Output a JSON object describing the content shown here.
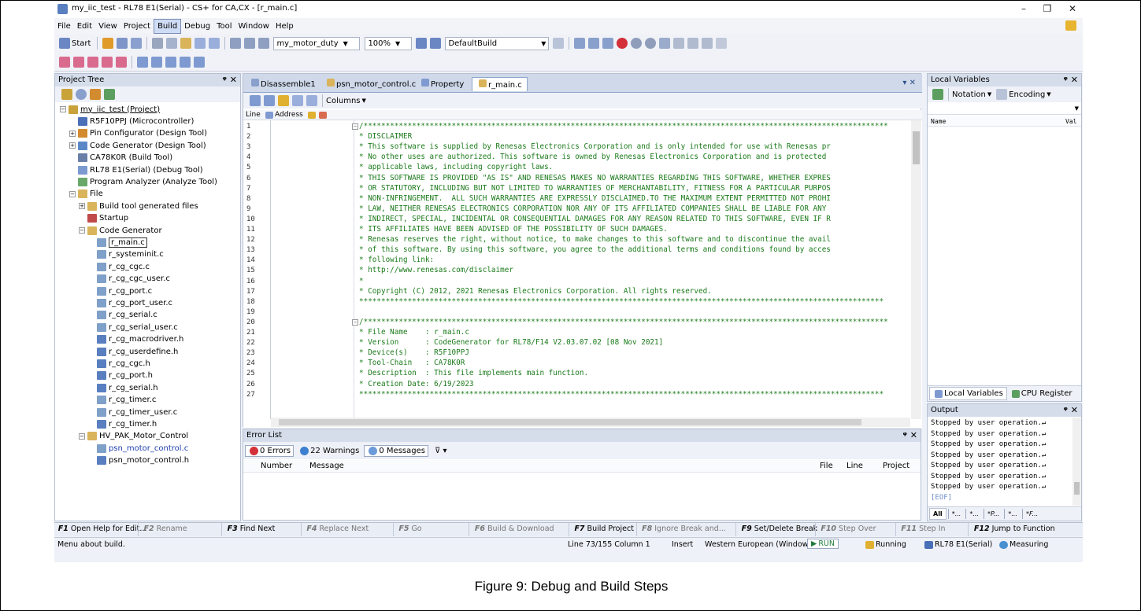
{
  "window": {
    "title": "my_iic_test - RL78 E1(Serial) - CS+ for CA,CX - [r_main.c]",
    "min": "–",
    "max": "❐",
    "close": "✕"
  },
  "menu": [
    "File",
    "Edit",
    "View",
    "Project",
    "Build",
    "Debug",
    "Tool",
    "Window",
    "Help"
  ],
  "toolbar": {
    "start": "Start",
    "function_combo": "my_motor_duty",
    "zoom_combo": "100%",
    "build_combo": "DefaultBuild"
  },
  "project_tree": {
    "title": "Project Tree",
    "items": [
      "my_iic_test (Project)",
      "R5F10PPJ (Microcontroller)",
      "Pin Configurator (Design Tool)",
      "Code Generator (Design Tool)",
      "CA78K0R (Build Tool)",
      "RL78 E1(Serial) (Debug Tool)",
      "Program Analyzer (Analyze Tool)",
      "File",
      "Build tool generated files",
      "Startup",
      "Code Generator",
      "r_main.c",
      "r_systeminit.c",
      "r_cg_cgc.c",
      "r_cg_cgc_user.c",
      "r_cg_port.c",
      "r_cg_port_user.c",
      "r_cg_serial.c",
      "r_cg_serial_user.c",
      "r_cg_macrodriver.h",
      "r_cg_userdefine.h",
      "r_cg_cgc.h",
      "r_cg_port.h",
      "r_cg_serial.h",
      "r_cg_timer.c",
      "r_cg_timer_user.c",
      "r_cg_timer.h",
      "HV_PAK_Motor_Control",
      "psn_motor_control.c",
      "psn_motor_control.h"
    ]
  },
  "editor": {
    "tabs": [
      "Disassemble1",
      "psn_motor_control.c",
      "Property",
      "r_main.c"
    ],
    "columns_label": "Columns",
    "col_line": "Line",
    "col_address": "Address",
    "line_numbers": [
      "1",
      "2",
      "3",
      "4",
      "5",
      "6",
      "7",
      "8",
      "9",
      "10",
      "11",
      "12",
      "13",
      "14",
      "15",
      "16",
      "17",
      "18",
      "19",
      "20",
      "21",
      "22",
      "23",
      "24",
      "25",
      "26",
      "27"
    ],
    "lines": [
      "/***********************************************************************************************************************",
      "* DISCLAIMER",
      "* This software is supplied by Renesas Electronics Corporation and is only intended for use with Renesas pr",
      "* No other uses are authorized. This software is owned by Renesas Electronics Corporation and is protected",
      "* applicable laws, including copyright laws.",
      "* THIS SOFTWARE IS PROVIDED \"AS IS\" AND RENESAS MAKES NO WARRANTIES REGARDING THIS SOFTWARE, WHETHER EXPRES",
      "* OR STATUTORY, INCLUDING BUT NOT LIMITED TO WARRANTIES OF MERCHANTABILITY, FITNESS FOR A PARTICULAR PURPOS",
      "* NON-INFRINGEMENT.  ALL SUCH WARRANTIES ARE EXPRESSLY DISCLAIMED.TO THE MAXIMUM EXTENT PERMITTED NOT PROHI",
      "* LAW, NEITHER RENESAS ELECTRONICS CORPORATION NOR ANY OF ITS AFFILIATED COMPANIES SHALL BE LIABLE FOR ANY",
      "* INDIRECT, SPECIAL, INCIDENTAL OR CONSEQUENTIAL DAMAGES FOR ANY REASON RELATED TO THIS SOFTWARE, EVEN IF R",
      "* ITS AFFILIATES HAVE BEEN ADVISED OF THE POSSIBILITY OF SUCH DAMAGES.",
      "* Renesas reserves the right, without notice, to make changes to this software and to discontinue the avail",
      "* of this software. By using this software, you agree to the additional terms and conditions found by acces",
      "* following link:",
      "* http://www.renesas.com/disclaimer",
      "*",
      "* Copyright (C) 2012, 2021 Renesas Electronics Corporation. All rights reserved.",
      "***********************************************************************************************************************",
      "",
      "/***********************************************************************************************************************",
      "* File Name    : r_main.c",
      "* Version      : CodeGenerator for RL78/F14 V2.03.07.02 [08 Nov 2021]",
      "* Device(s)    : R5F10PPJ",
      "* Tool-Chain   : CA78K0R",
      "* Description  : This file implements main function.",
      "* Creation Date: 6/19/2023",
      "***********************************************************************************************************************"
    ]
  },
  "error_list": {
    "title": "Error List",
    "errors": "0 Errors",
    "warnings": "22 Warnings",
    "messages": "0 Messages",
    "cols": {
      "number": "Number",
      "message": "Message",
      "file": "File",
      "line": "Line",
      "project": "Project"
    }
  },
  "local_vars": {
    "title": "Local Variables",
    "notation": "Notation",
    "encoding": "Encoding",
    "col_name": "Name",
    "col_value": "Val",
    "tab1": "Local Variables",
    "tab2": "CPU Register"
  },
  "output": {
    "title": "Output",
    "lines": [
      "Stopped by user operation.↵",
      "Stopped by user operation.↵",
      "Stopped by user operation.↵",
      "Stopped by user operation.↵",
      "Stopped by user operation.↵",
      "Stopped by user operation.↵",
      "Stopped by user operation.↵",
      "[EOF]"
    ],
    "tabs": [
      "All",
      "*...",
      "*...",
      "*P...",
      "*...",
      "*F..."
    ]
  },
  "fkeys": [
    {
      "k": "F1",
      "label": "Open Help for Edit..."
    },
    {
      "k": "F2",
      "label": "Rename"
    },
    {
      "k": "F3",
      "label": "Find Next"
    },
    {
      "k": "F4",
      "label": "Replace Next"
    },
    {
      "k": "F5",
      "label": "Go"
    },
    {
      "k": "F6",
      "label": "Build & Download"
    },
    {
      "k": "F7",
      "label": "Build Project"
    },
    {
      "k": "F8",
      "label": "Ignore Break and..."
    },
    {
      "k": "F9",
      "label": "Set/Delete Break"
    },
    {
      "k": "F10",
      "label": "Step Over"
    },
    {
      "k": "F11",
      "label": "Step In"
    },
    {
      "k": "F12",
      "label": "Jump to Function"
    }
  ],
  "status": {
    "hint": "Menu about build.",
    "position": "Line 73/155  Column 1",
    "mode": "Insert",
    "encoding": "Western European (Windows)",
    "run": "RUN",
    "running": "Running",
    "debugger": "RL78 E1(Serial)",
    "measuring": "Measuring"
  },
  "caption": "Figure 9: Debug and Build Steps"
}
